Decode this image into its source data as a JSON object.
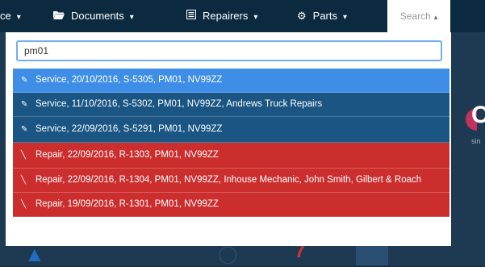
{
  "navbar": {
    "items": [
      {
        "label": "ce",
        "icon": "",
        "caret": "▾"
      },
      {
        "label": "Documents",
        "icon": "folder-open-icon",
        "caret": "▾"
      },
      {
        "label": "Repairers",
        "icon": "list-icon",
        "caret": "▾"
      },
      {
        "label": "Parts",
        "icon": "gear-icon",
        "caret": "▾"
      }
    ],
    "search_label": "Search",
    "search_caret": "▴"
  },
  "search": {
    "value": "pm01"
  },
  "results": [
    {
      "type": "service",
      "icon": "wrench-icon",
      "text": "Service, 20/10/2016, S-5305, PM01, NV99ZZ",
      "active": true
    },
    {
      "type": "service",
      "icon": "wrench-icon",
      "text": "Service, 11/10/2016, S-5302, PM01, NV99ZZ, Andrews Truck Repairs"
    },
    {
      "type": "service",
      "icon": "wrench-icon",
      "text": "Service, 22/09/2016, S-5291, PM01, NV99ZZ"
    },
    {
      "type": "repair",
      "icon": "hammer-icon",
      "text": "Repair, 22/09/2016, R-1303, PM01, NV99ZZ"
    },
    {
      "type": "repair",
      "icon": "hammer-icon",
      "text": "Repair, 22/09/2016, R-1304, PM01, NV99ZZ, Inhouse Mechanic, John Smith, Gilbert & Roach"
    },
    {
      "type": "repair",
      "icon": "hammer-icon",
      "text": "Repair, 19/09/2016, R-1301, PM01, NV99ZZ"
    }
  ],
  "background": {
    "side_letter": "C",
    "side_sub": "sin",
    "bottom_number": "7"
  },
  "colors": {
    "navbar": "#0b2a40",
    "service_row": "#1a5584",
    "service_row_active": "#3e8ee8",
    "repair_row": "#cc2e2e",
    "input_focus_border": "#74aef0"
  }
}
